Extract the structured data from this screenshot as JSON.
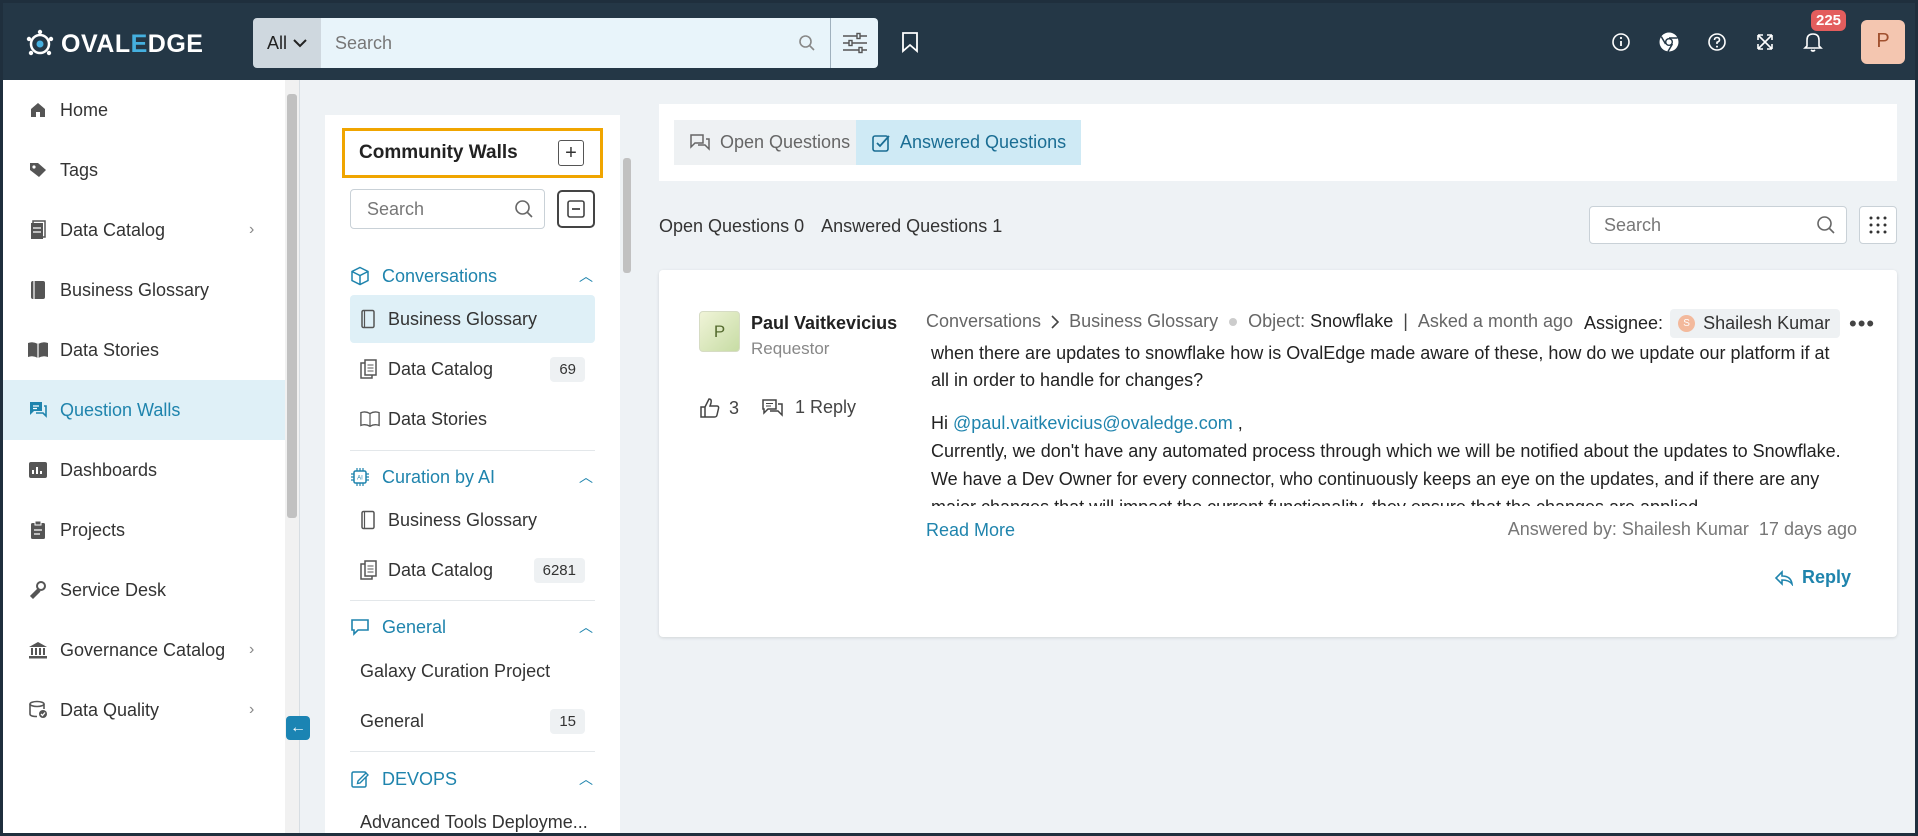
{
  "colors": {
    "topbar": "#243746",
    "accent": "#1f84ad",
    "highlight": "#f0a500",
    "badge": "#e35d5d"
  },
  "header": {
    "logo_prefix": "OVAL",
    "logo_accent": "E",
    "logo_suffix": "DGE",
    "scope": "All",
    "search_placeholder": "Search",
    "notification_count": "225",
    "user_initial": "P"
  },
  "nav": {
    "items": [
      {
        "label": "Home",
        "icon": "home-icon"
      },
      {
        "label": "Tags",
        "icon": "tag-icon"
      },
      {
        "label": "Data Catalog",
        "icon": "catalog-icon"
      },
      {
        "label": "Business Glossary",
        "icon": "book-icon"
      },
      {
        "label": "Data Stories",
        "icon": "open-book-icon"
      },
      {
        "label": "Question Walls",
        "icon": "chat-icon"
      },
      {
        "label": "Dashboards",
        "icon": "dashboard-icon"
      },
      {
        "label": "Projects",
        "icon": "clipboard-icon"
      },
      {
        "label": "Service Desk",
        "icon": "service-icon"
      },
      {
        "label": "Governance Catalog",
        "icon": "bank-icon"
      },
      {
        "label": "Data Quality",
        "icon": "quality-icon"
      }
    ]
  },
  "wall": {
    "title": "Community Walls",
    "search_placeholder": "Search",
    "sections": [
      {
        "title": "Conversations",
        "items": [
          {
            "label": "Business Glossary",
            "count": ""
          },
          {
            "label": "Data Catalog",
            "count": "69"
          },
          {
            "label": "Data Stories",
            "count": ""
          }
        ]
      },
      {
        "title": "Curation by AI",
        "items": [
          {
            "label": "Business Glossary",
            "count": ""
          },
          {
            "label": "Data Catalog",
            "count": "6281"
          }
        ]
      },
      {
        "title": "General",
        "items": [
          {
            "label": "Galaxy Curation Project",
            "count": ""
          },
          {
            "label": "General",
            "count": "15"
          }
        ]
      },
      {
        "title": "DEVOPS",
        "items": [
          {
            "label": "Advanced Tools Deployme...",
            "count": ""
          }
        ]
      }
    ]
  },
  "content": {
    "tabs": {
      "open": "Open Questions",
      "answered": "Answered Questions"
    },
    "counts": {
      "open": "Open Questions 0",
      "answered": "Answered Questions 1"
    },
    "search_placeholder": "Search",
    "card": {
      "avatar_initial": "P",
      "name": "Paul Vaitkevicius",
      "role": "Requestor",
      "likes": "3",
      "replies": "1 Reply",
      "crumb1": "Conversations",
      "crumb2": "Business Glossary",
      "object_label": "Object:",
      "object_value": "Snowflake",
      "sep": "|",
      "asked": "Asked a month ago",
      "assignee_label": "Assignee:",
      "assignee_initial": "S",
      "assignee_name": "Shailesh Kumar",
      "more": "•••",
      "question": "when there are updates to snowflake how is OvalEdge made aware of these, how do we update our platform if at all in order to handle for changes?",
      "answer_hi": "Hi",
      "answer_mention": "@paul.vaitkevicius@ovaledge.com",
      "answer_comma": ",",
      "answer_line1": "Currently, we don't have any automated process through which we will be notified about the updates to Snowflake.",
      "answer_line2": "We have a Dev Owner for every connector, who continuously keeps an eye on the updates, and if there are any major changes that will impact the current functionality, they ensure that the changes are applied.",
      "read_more": "Read More",
      "answered_by": "Answered by: Shailesh Kumar",
      "answered_ago": "17 days ago",
      "reply_label": "Reply"
    }
  }
}
